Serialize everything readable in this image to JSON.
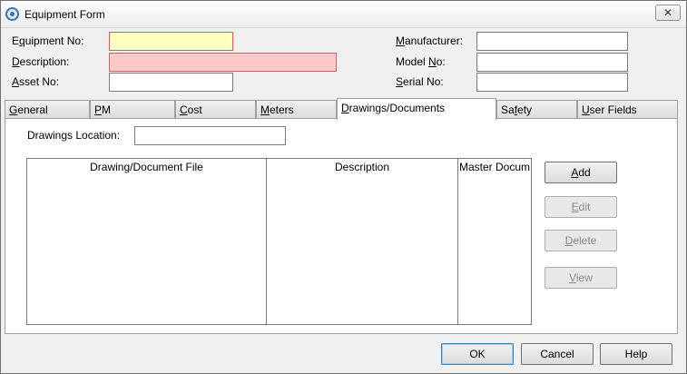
{
  "window": {
    "title": "Equipment Form",
    "close_symbol": "✕"
  },
  "header_fields": {
    "equipment_no": {
      "label_pre": "E",
      "label_u": "q",
      "label_post": "uipment No:",
      "value": ""
    },
    "description": {
      "label_pre": "",
      "label_u": "D",
      "label_post": "escription:",
      "value": ""
    },
    "asset_no": {
      "label_pre": "",
      "label_u": "A",
      "label_post": "sset No:",
      "value": ""
    },
    "manufacturer": {
      "label_pre": "",
      "label_u": "M",
      "label_post": "anufacturer:",
      "value": ""
    },
    "model_no": {
      "label_pre": "Model ",
      "label_u": "N",
      "label_post": "o:",
      "value": ""
    },
    "serial_no": {
      "label_pre": "",
      "label_u": "S",
      "label_post": "erial No:",
      "value": ""
    }
  },
  "tabs": [
    {
      "pre": "",
      "u": "G",
      "post": "eneral"
    },
    {
      "pre": "",
      "u": "P",
      "post": "M"
    },
    {
      "pre": "",
      "u": "C",
      "post": "ost"
    },
    {
      "pre": "",
      "u": "M",
      "post": "eters"
    },
    {
      "pre": "",
      "u": "D",
      "post": "rawings/Documents"
    },
    {
      "pre": "Sa",
      "u": "f",
      "post": "ety"
    },
    {
      "pre": "",
      "u": "U",
      "post": "ser Fields"
    }
  ],
  "drawings": {
    "location_label": "Drawings Location:",
    "location_value": "",
    "columns": [
      "Drawing/Document File",
      "Description",
      "Master Docum"
    ]
  },
  "side_buttons": [
    {
      "u": "A",
      "post": "dd"
    },
    {
      "u": "E",
      "post": "dit"
    },
    {
      "u": "D",
      "post": "elete"
    },
    {
      "u": "V",
      "post": "iew"
    }
  ],
  "footer": {
    "ok": "OK",
    "cancel": "Cancel",
    "help": "Help"
  },
  "colors": {
    "required_yellow": "#ffffc0",
    "required_pink": "#ffc8c8",
    "accent": "#3c7fb1"
  }
}
